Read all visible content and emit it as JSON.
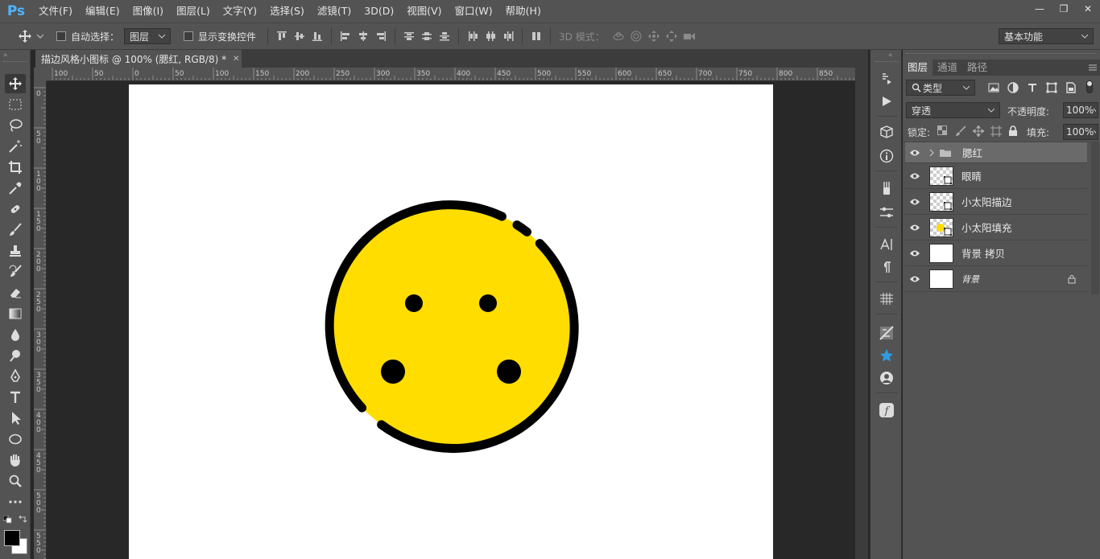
{
  "app": {
    "logo": "Ps"
  },
  "menu": [
    "文件(F)",
    "编辑(E)",
    "图像(I)",
    "图层(L)",
    "文字(Y)",
    "选择(S)",
    "滤镜(T)",
    "3D(D)",
    "视图(V)",
    "窗口(W)",
    "帮助(H)"
  ],
  "window": {
    "minimize": "—",
    "restore": "❐",
    "close": "✕"
  },
  "options": {
    "auto_select_label": "自动选择：",
    "auto_select_target": "图层",
    "show_transform_label": "显示变换控件",
    "mode_3d_label": "3D 模式：",
    "workspace": "基本功能"
  },
  "document": {
    "tab_title": "描边风格小图标 @ 100% (腮红, RGB/8) *",
    "tab_close": "✕"
  },
  "rulers": {
    "h_ticks": [
      "100",
      "50",
      "0",
      "50",
      "100",
      "150",
      "200",
      "250",
      "300",
      "350",
      "400",
      "450",
      "500",
      "550",
      "600",
      "650",
      "700",
      "750",
      "800",
      "850"
    ],
    "v_ticks": [
      "0",
      "5 0",
      "1 0 0",
      "1 5 0",
      "2 0 0",
      "2 5 0",
      "3 0 0",
      "3 5 0",
      "4 0 0",
      "4 5 0",
      "5 0 0",
      "5 5 0"
    ]
  },
  "panel": {
    "tabs": [
      "图层",
      "通道",
      "路径"
    ],
    "filter_kind": "类型",
    "blend_mode": "穿透",
    "opacity_label": "不透明度:",
    "opacity_value": "100%",
    "lock_label": "锁定:",
    "fill_label": "填充:",
    "fill_value": "100%"
  },
  "layers": [
    {
      "name": "腮红",
      "type": "group",
      "selected": true
    },
    {
      "name": "眼睛",
      "type": "shape",
      "selected": false
    },
    {
      "name": "小太阳描边",
      "type": "shape",
      "selected": false
    },
    {
      "name": "小太阳填充",
      "type": "shape",
      "selected": false
    },
    {
      "name": "背景 拷贝",
      "type": "pixel",
      "selected": false
    },
    {
      "name": "背景",
      "type": "background",
      "selected": false,
      "locked": true
    }
  ],
  "colors": {
    "face_fill": "#FFDD00",
    "stroke": "#000000",
    "foreground": "#000000",
    "background": "#FFFFFF",
    "ui_panel": "#535353",
    "ui_dark": "#282828"
  }
}
